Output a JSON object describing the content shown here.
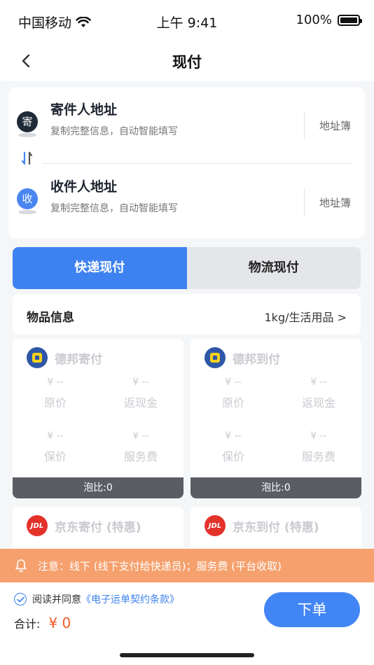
{
  "status_bar": {
    "carrier": "中国移动",
    "time": "上午 9:41",
    "battery": "100%"
  },
  "nav": {
    "title": "现付"
  },
  "sender": {
    "badge": "寄",
    "title": "寄件人地址",
    "subtitle": "复制完整信息，自动智能填写",
    "book": "地址簿"
  },
  "receiver": {
    "badge": "收",
    "title": "收件人地址",
    "subtitle": "复制完整信息，自动智能填写",
    "book": "地址簿"
  },
  "tabs": [
    {
      "label": "快递现付",
      "active": true
    },
    {
      "label": "物流现付",
      "active": false
    }
  ],
  "goods": {
    "label": "物品信息",
    "value": "1kg/生活用品 >"
  },
  "carriers": [
    {
      "name": "德邦寄付",
      "logo": "db",
      "cells": [
        {
          "amount": "¥ --",
          "label": "原价"
        },
        {
          "amount": "¥ --",
          "label": "返现金"
        },
        {
          "amount": "¥ --",
          "label": "保价"
        },
        {
          "amount": "¥ --",
          "label": "服务费"
        }
      ],
      "ratio": "泡比:0"
    },
    {
      "name": "德邦到付",
      "logo": "db",
      "cells": [
        {
          "amount": "¥ --",
          "label": "原价"
        },
        {
          "amount": "¥ --",
          "label": "返现金"
        },
        {
          "amount": "¥ --",
          "label": "保价"
        },
        {
          "amount": "¥ --",
          "label": "服务费"
        }
      ],
      "ratio": "泡比:0"
    },
    {
      "name": "京东寄付 (特惠)",
      "logo": "jd",
      "logo_text": "JDL"
    },
    {
      "name": "京东到付 (特惠)",
      "logo": "jd",
      "logo_text": "JDL"
    }
  ],
  "notice": {
    "text": "注意：线下 (线下支付给快递员)；服务费 (平台收取)"
  },
  "bottom": {
    "agree_prefix": "阅读并同意",
    "agree_link": "《电子运单契约条款》",
    "total_label": "合计:",
    "total_amount": "¥ 0",
    "order_button": "下单"
  },
  "colors": {
    "accent": "#3d82f0",
    "notice": "#f5a06d",
    "price": "#f05a2a"
  }
}
